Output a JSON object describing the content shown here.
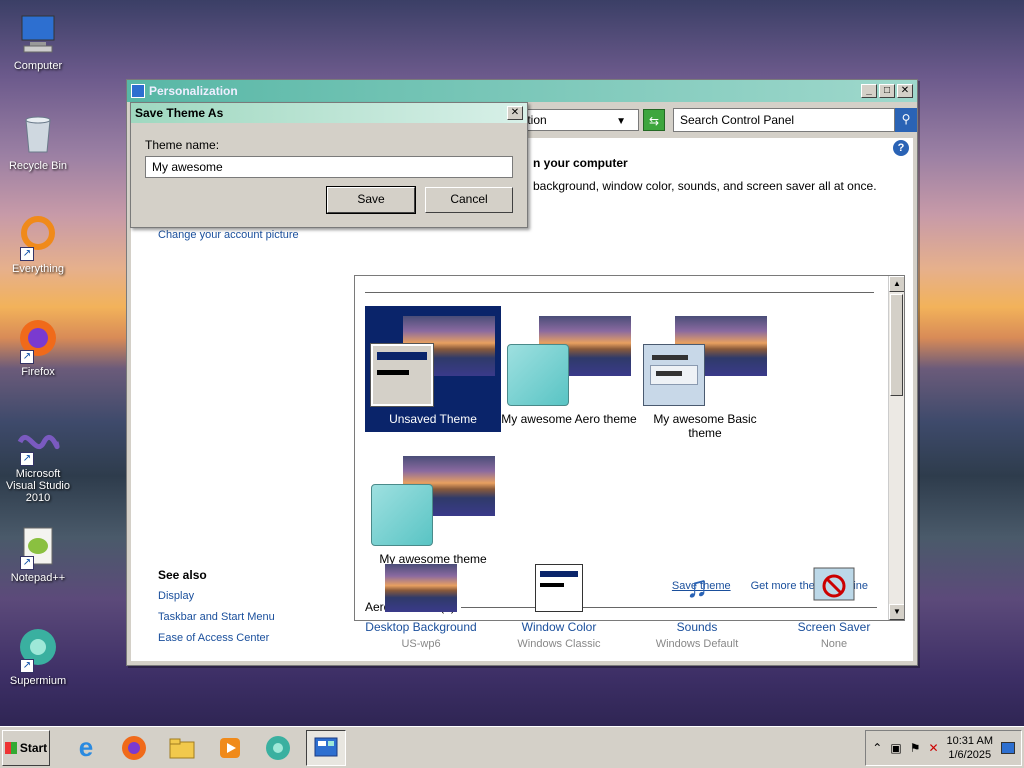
{
  "desktop": {
    "icons": [
      {
        "label": "Computer"
      },
      {
        "label": "Recycle Bin"
      },
      {
        "label": "Everything"
      },
      {
        "label": "Firefox"
      },
      {
        "label": "Microsoft Visual Studio 2010"
      },
      {
        "label": "Notepad++"
      },
      {
        "label": "Supermium"
      }
    ]
  },
  "window": {
    "title": "Personalization",
    "address": "ization",
    "search_placeholder": "Search Control Panel",
    "heading": "n your computer",
    "subheading": "background, window color, sounds, and screen saver all at once.",
    "left_links": [
      "Change your account picture"
    ],
    "themes": [
      {
        "label": "Unsaved Theme"
      },
      {
        "label": "My awesome Aero theme"
      },
      {
        "label": "My awesome Basic theme"
      },
      {
        "label": "My awesome theme"
      }
    ],
    "save_theme_link": "Save theme",
    "get_more_link": "Get more themes online",
    "aero_themes_label": "Aero Themes (7)",
    "see_also": {
      "heading": "See also",
      "links": [
        "Display",
        "Taskbar and Start Menu",
        "Ease of Access Center"
      ]
    },
    "bottom_items": [
      {
        "title": "Desktop Background",
        "sub": "US-wp6"
      },
      {
        "title": "Window Color",
        "sub": "Windows Classic"
      },
      {
        "title": "Sounds",
        "sub": "Windows Default"
      },
      {
        "title": "Screen Saver",
        "sub": "None"
      }
    ]
  },
  "dialog": {
    "title": "Save Theme As",
    "field_label": "Theme name:",
    "field_value": "My awesome",
    "save_label": "Save",
    "cancel_label": "Cancel"
  },
  "taskbar": {
    "start_label": "Start",
    "time": "10:31 AM",
    "date": "1/6/2025"
  },
  "colors": {
    "selected_bg": "#0a246a",
    "link": "#1a4f9c",
    "title_grad": "#58b7a6"
  }
}
